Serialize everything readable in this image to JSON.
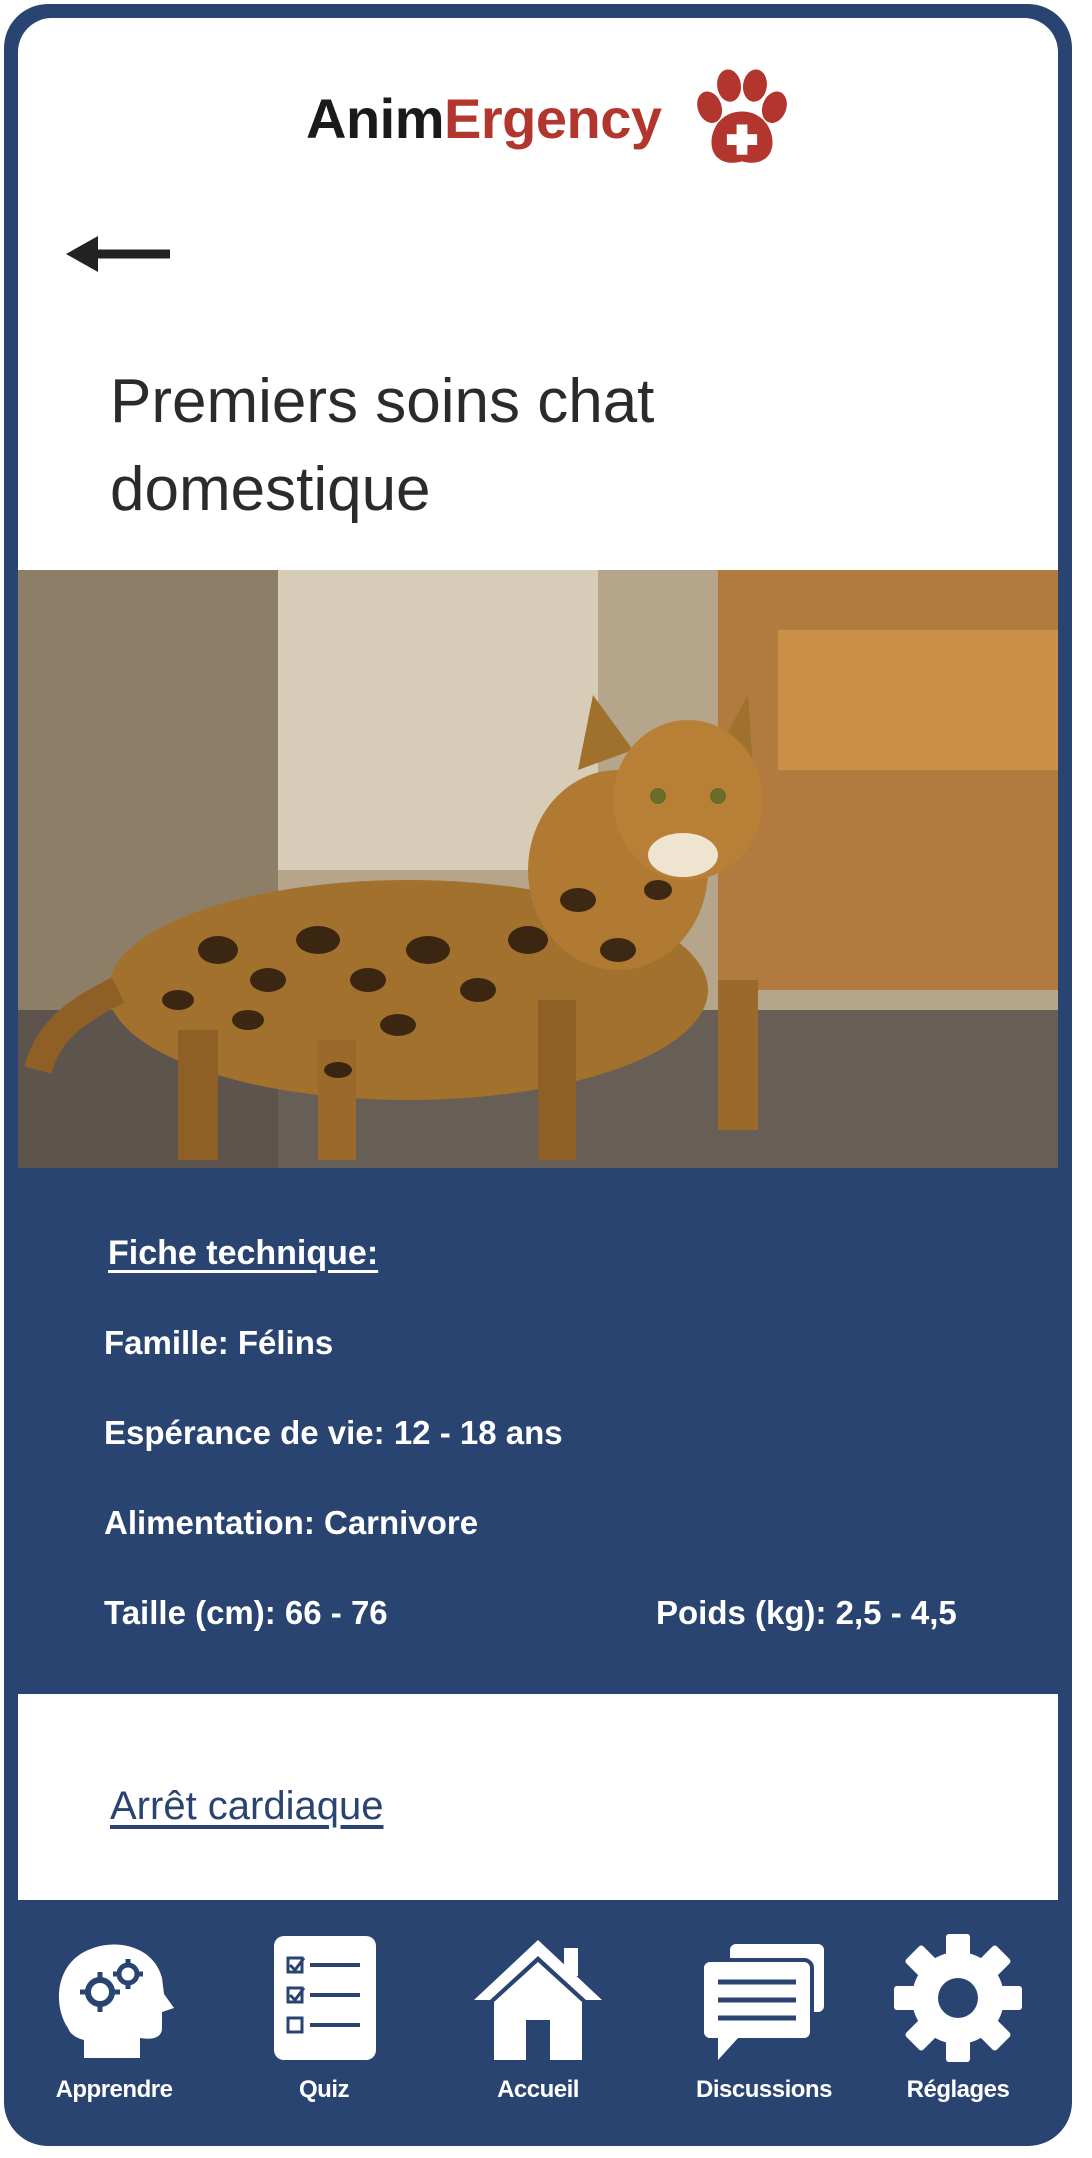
{
  "brand": {
    "part1": "Anim",
    "part2": "Ergency",
    "accent_color": "#b2362e",
    "icon": "paw-cross-icon"
  },
  "header": {
    "back_icon": "arrow-left-icon"
  },
  "page": {
    "title": "Premiers soins chat domestique"
  },
  "hero": {
    "subject": "Bengal cat photo"
  },
  "sheet": {
    "title": "Fiche technique:",
    "famille": "Famille: Félins",
    "esperance": "Espérance de vie: 12 - 18 ans",
    "alimentation": "Alimentation: Carnivore",
    "taille": "Taille (cm): 66 - 76",
    "poids": "Poids (kg): 2,5 - 4,5"
  },
  "section": {
    "link": "Arrêt cardiaque"
  },
  "nav": {
    "apprendre": {
      "label": "Apprendre",
      "icon": "brain-gears-icon"
    },
    "quiz": {
      "label": "Quiz",
      "icon": "checklist-icon"
    },
    "accueil": {
      "label": "Accueil",
      "icon": "home-icon"
    },
    "discussions": {
      "label": "Discussions",
      "icon": "chat-bubbles-icon"
    },
    "reglages": {
      "label": "Réglages",
      "icon": "gear-icon"
    }
  },
  "colors": {
    "primary": "#2a4472",
    "text_dark": "#2b2b2b",
    "white": "#ffffff"
  }
}
